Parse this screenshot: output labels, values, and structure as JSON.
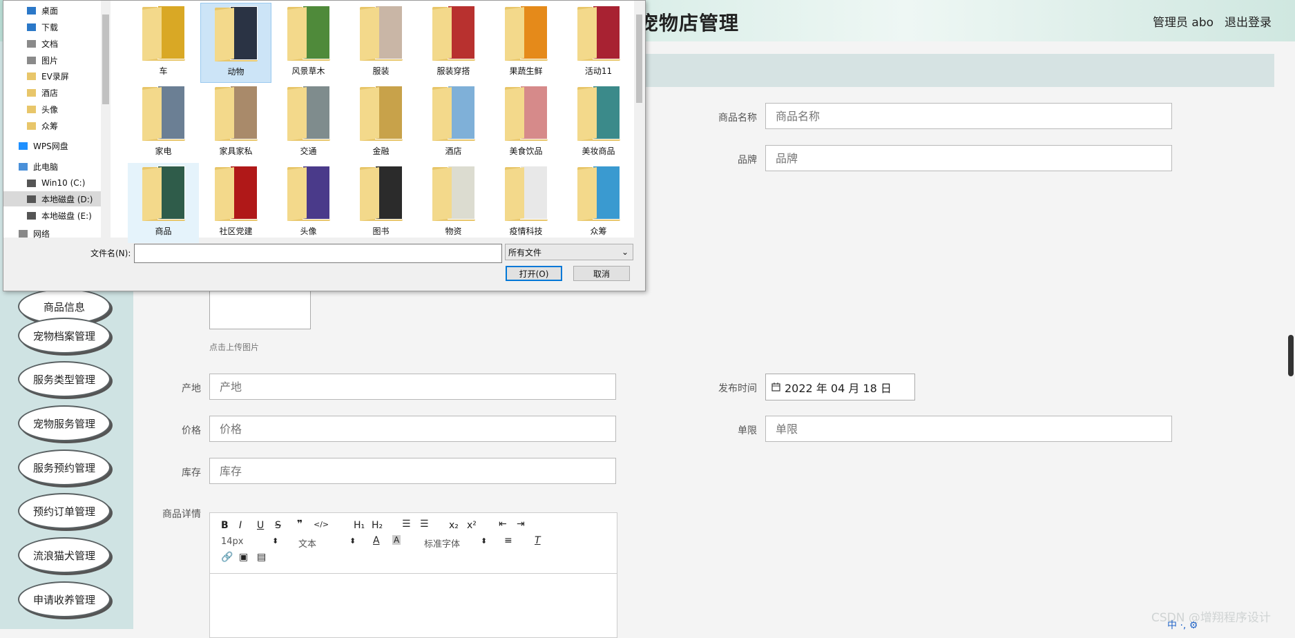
{
  "header": {
    "title": "宠物店管理",
    "admin": "管理员 abo",
    "logout": "退出登录"
  },
  "sidebar": {
    "items": [
      "商品信息",
      "宠物档案管理",
      "服务类型管理",
      "宠物服务管理",
      "服务预约管理",
      "预约订单管理",
      "流浪猫犬管理",
      "申请收养管理"
    ]
  },
  "form": {
    "name": {
      "label": "商品名称",
      "placeholder": "商品名称"
    },
    "brand": {
      "label": "品牌",
      "placeholder": "品牌"
    },
    "upload_hint": "点击上传图片",
    "origin": {
      "label": "产地",
      "placeholder": "产地"
    },
    "publish_time": {
      "label": "发布时间",
      "value": "2022 年 04 月 18 日"
    },
    "price": {
      "label": "价格",
      "placeholder": "价格"
    },
    "limit": {
      "label": "单限",
      "placeholder": "单限"
    },
    "stock": {
      "label": "库存",
      "placeholder": "库存"
    },
    "detail": {
      "label": "商品详情"
    },
    "editor": {
      "font_size": "14px",
      "text_style": "文本",
      "font_family": "标准字体"
    }
  },
  "watermark": "CSDN @增翔程序设计",
  "tray": "中 ·, ⚙",
  "dialog": {
    "nav": [
      {
        "label": "桌面",
        "pin": true
      },
      {
        "label": "下载",
        "pin": true
      },
      {
        "label": "文档",
        "pin": true
      },
      {
        "label": "图片",
        "pin": true
      },
      {
        "label": "EV录屏"
      },
      {
        "label": "酒店"
      },
      {
        "label": "头像"
      },
      {
        "label": "众筹"
      },
      {
        "label": "WPS网盘"
      },
      {
        "label": "此电脑"
      },
      {
        "label": "Win10 (C:)"
      },
      {
        "label": "本地磁盘 (D:)"
      },
      {
        "label": "本地磁盘 (E:)"
      },
      {
        "label": "网络"
      }
    ],
    "files": [
      "车",
      "动物",
      "风景草木",
      "服装",
      "服装穿搭",
      "果蔬生鲜",
      "活动11",
      "家电",
      "家具家私",
      "交通",
      "金融",
      "酒店",
      "美食饮品",
      "美妆商品",
      "商品",
      "社区党建",
      "头像",
      "图书",
      "物资",
      "疫情科技",
      "众筹"
    ],
    "filename_label": "文件名(N):",
    "filetype": "所有文件",
    "open": "打开(O)",
    "cancel": "取消",
    "colors": {
      "selected": "#cce4f7",
      "accent": "#0078d7"
    }
  }
}
